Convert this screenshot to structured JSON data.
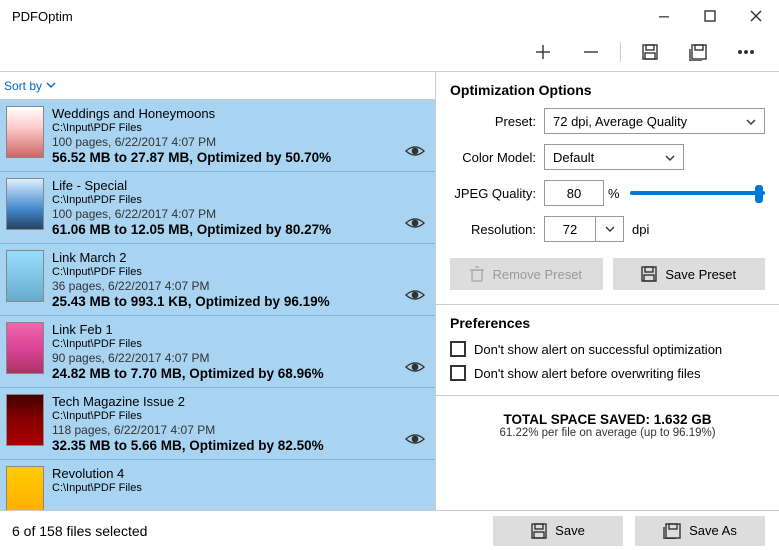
{
  "window": {
    "title": "PDFOptim"
  },
  "sort": {
    "label": "Sort by"
  },
  "files": [
    {
      "title": "Weddings and Honeymoons",
      "path": "C:\\Input\\PDF Files",
      "meta": "100 pages,  6/22/2017 4:07 PM",
      "result": "56.52 MB to 27.87 MB, Optimized by 50.70%",
      "thumb": "t1"
    },
    {
      "title": "Life - Special",
      "path": "C:\\Input\\PDF Files",
      "meta": "100 pages,  6/22/2017 4:07 PM",
      "result": "61.06 MB to 12.05 MB, Optimized by 80.27%",
      "thumb": "t2"
    },
    {
      "title": "Link March 2",
      "path": "C:\\Input\\PDF Files",
      "meta": "36 pages,  6/22/2017 4:07 PM",
      "result": "25.43 MB to 993.1 KB, Optimized by 96.19%",
      "thumb": "t3"
    },
    {
      "title": "Link Feb 1",
      "path": "C:\\Input\\PDF Files",
      "meta": "90 pages,  6/22/2017 4:07 PM",
      "result": "24.82 MB to 7.70 MB, Optimized by 68.96%",
      "thumb": "t4"
    },
    {
      "title": "Tech Magazine Issue 2",
      "path": "C:\\Input\\PDF Files",
      "meta": "118 pages,  6/22/2017 4:07 PM",
      "result": "32.35 MB to 5.66 MB, Optimized by 82.50%",
      "thumb": "t5"
    },
    {
      "title": "Revolution 4",
      "path": "C:\\Input\\PDF Files",
      "meta": "",
      "result": "",
      "thumb": "t6"
    }
  ],
  "options": {
    "heading": "Optimization Options",
    "preset_label": "Preset:",
    "preset_value": "72 dpi, Average Quality",
    "color_label": "Color Model:",
    "color_value": "Default",
    "jpeg_label": "JPEG Quality:",
    "jpeg_value": "80",
    "jpeg_pct": "%",
    "res_label": "Resolution:",
    "res_value": "72",
    "res_unit": "dpi",
    "remove_preset": "Remove Preset",
    "save_preset": "Save Preset"
  },
  "prefs": {
    "heading": "Preferences",
    "opt1": "Don't show alert on successful optimization",
    "opt2": "Don't show alert before overwriting files"
  },
  "totals": {
    "main": "TOTAL SPACE SAVED: 1.632 GB",
    "sub": "61.22% per file on average (up to 96.19%)"
  },
  "footer": {
    "status": "6 of 158 files selected",
    "save": "Save",
    "save_as": "Save As"
  }
}
